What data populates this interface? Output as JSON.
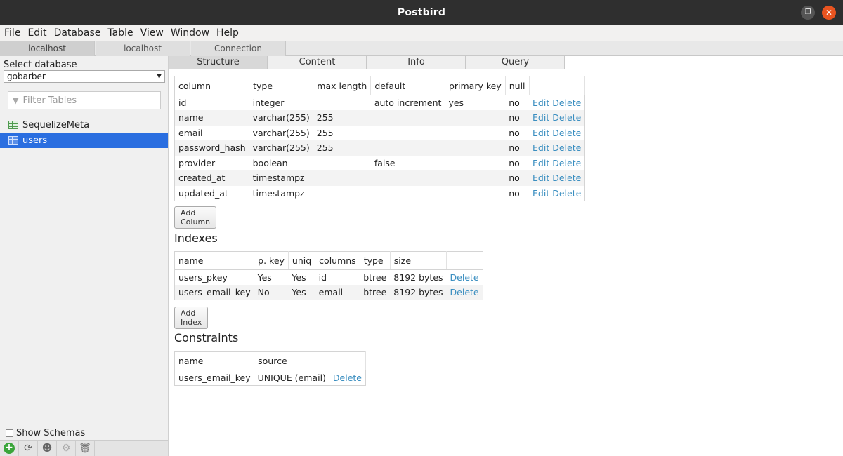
{
  "window": {
    "title": "Postbird"
  },
  "menu": [
    "File",
    "Edit",
    "Database",
    "Table",
    "View",
    "Window",
    "Help"
  ],
  "connection_tabs": [
    "localhost",
    "localhost",
    "Connection"
  ],
  "sidebar": {
    "select_label": "Select database",
    "database": "gobarber",
    "filter_placeholder": "Filter Tables",
    "tables": [
      "SequelizeMeta",
      "users"
    ],
    "selected_table": "users",
    "show_schemas": "Show Schemas"
  },
  "main_tabs": [
    "Structure",
    "Content",
    "Info",
    "Query"
  ],
  "structure": {
    "headers": [
      "column",
      "type",
      "max length",
      "default",
      "primary key",
      "null",
      ""
    ],
    "rows": [
      [
        "id",
        "integer",
        "",
        "auto increment",
        "yes",
        "no"
      ],
      [
        "name",
        "varchar(255)",
        "255",
        "",
        "",
        "no"
      ],
      [
        "email",
        "varchar(255)",
        "255",
        "",
        "",
        "no"
      ],
      [
        "password_hash",
        "varchar(255)",
        "255",
        "",
        "",
        "no"
      ],
      [
        "provider",
        "boolean",
        "",
        "false",
        "",
        "no"
      ],
      [
        "created_at",
        "timestampz",
        "",
        "",
        "",
        "no"
      ],
      [
        "updated_at",
        "timestampz",
        "",
        "",
        "",
        "no"
      ]
    ],
    "edit_label": "Edit",
    "delete_label": "Delete",
    "add_button": "Add Column"
  },
  "indexes": {
    "title": "Indexes",
    "headers": [
      "name",
      "p. key",
      "uniq",
      "columns",
      "type",
      "size",
      ""
    ],
    "rows": [
      [
        "users_pkey",
        "Yes",
        "Yes",
        "id",
        "btree",
        "8192 bytes"
      ],
      [
        "users_email_key",
        "No",
        "Yes",
        "email",
        "btree",
        "8192 bytes"
      ]
    ],
    "delete_label": "Delete",
    "add_button": "Add Index"
  },
  "constraints": {
    "title": "Constraints",
    "headers": [
      "name",
      "source",
      ""
    ],
    "rows": [
      [
        "users_email_key",
        "UNIQUE (email)"
      ]
    ],
    "delete_label": "Delete"
  }
}
